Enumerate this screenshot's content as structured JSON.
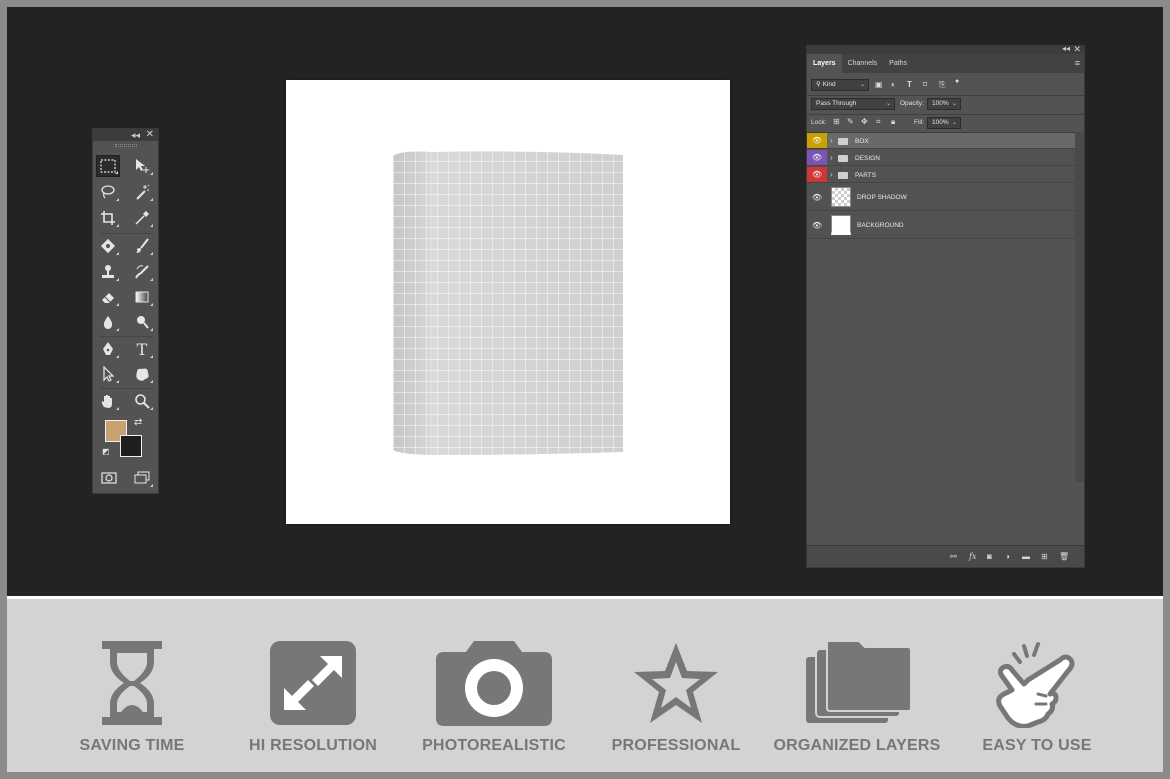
{
  "colors": {
    "workspace": "#232323",
    "panel": "#535353",
    "foreground_swatch": "#c8a171",
    "background_swatch": "#1e1e1e",
    "feature_icon": "#777777",
    "layer_box_tag": "#c8a000",
    "layer_design_tag": "#7b55b5",
    "layer_parts_tag": "#d03636"
  },
  "tools": [
    "rectangular-marquee-icon",
    "move-icon",
    "lasso-icon",
    "magic-wand-icon",
    "crop-icon",
    "eyedropper-icon",
    "healing-brush-icon",
    "brush-icon",
    "clone-stamp-icon",
    "history-brush-icon",
    "eraser-icon",
    "gradient-icon",
    "blur-icon",
    "dodge-icon",
    "pen-icon",
    "type-icon",
    "path-selection-icon",
    "shape-icon",
    "hand-icon",
    "zoom-icon"
  ],
  "layers_panel": {
    "tabs": [
      "Layers",
      "Channels",
      "Paths"
    ],
    "filter": {
      "value": "Kind"
    },
    "blend_mode": {
      "value": "Pass Through"
    },
    "opacity": {
      "label": "Opacity:",
      "value": "100%"
    },
    "lock": {
      "label": "Lock:"
    },
    "fill": {
      "label": "Fill:",
      "value": "100%"
    },
    "layers": [
      {
        "name": "BOX",
        "type": "group",
        "color": "#c8a000",
        "selected": true
      },
      {
        "name": "DESIGN",
        "type": "group",
        "color": "#7b55b5",
        "selected": false
      },
      {
        "name": "PARTS",
        "type": "group",
        "color": "#d03636",
        "selected": false
      },
      {
        "name": "DROP SHADOW",
        "type": "layer",
        "thumbnail": "transparent"
      },
      {
        "name": "BACKGROUND",
        "type": "layer",
        "thumbnail": "white"
      }
    ]
  },
  "features": [
    {
      "label": "SAVING TIME",
      "icon": "hourglass-icon"
    },
    {
      "label": "HI RESOLUTION",
      "icon": "expand-arrows-icon"
    },
    {
      "label": "PHOTOREALISTIC",
      "icon": "camera-icon"
    },
    {
      "label": "PROFESSIONAL",
      "icon": "star-icon"
    },
    {
      "label": "ORGANIZED LAYERS",
      "icon": "folders-icon"
    },
    {
      "label": "EASY TO USE",
      "icon": "pointing-hand-icon"
    }
  ]
}
